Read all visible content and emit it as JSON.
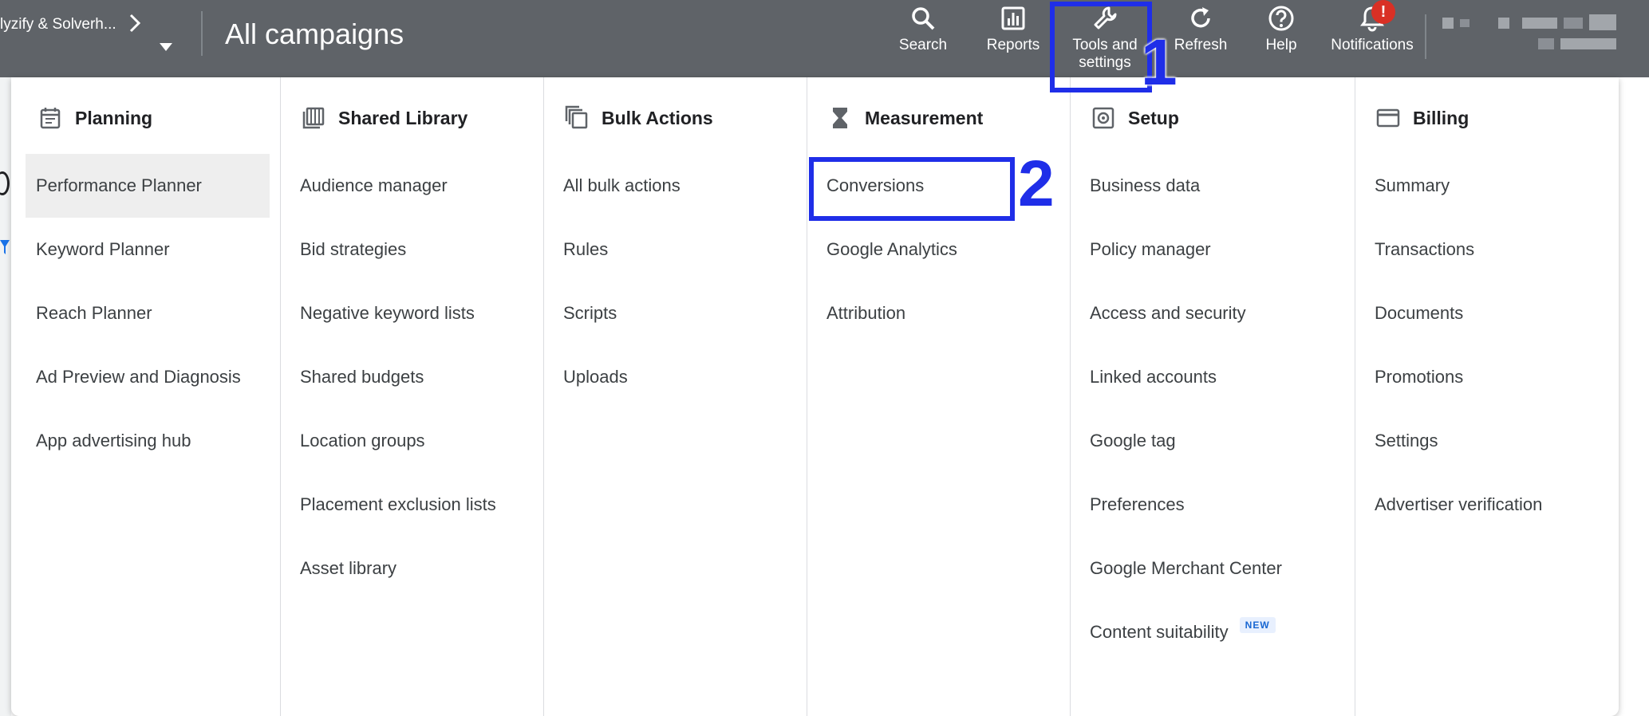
{
  "header": {
    "account_name": "lyzify & Solverh...",
    "page_title": "All campaigns",
    "actions": [
      {
        "id": "search",
        "label": "Search",
        "icon": "search-icon"
      },
      {
        "id": "reports",
        "label": "Reports",
        "icon": "bar-chart-icon"
      },
      {
        "id": "tools",
        "label": "Tools and settings",
        "icon": "wrench-icon"
      },
      {
        "id": "refresh",
        "label": "Refresh",
        "icon": "refresh-icon"
      },
      {
        "id": "help",
        "label": "Help",
        "icon": "help-icon"
      },
      {
        "id": "notifications",
        "label": "Notifications",
        "icon": "bell-icon"
      }
    ],
    "notification_badge": "!",
    "tools_label_line1": "Tools and",
    "tools_label_line2": "settings"
  },
  "menu": {
    "columns": [
      {
        "title": "Planning",
        "icon": "calendar-icon",
        "items": [
          "Performance Planner",
          "Keyword Planner",
          "Reach Planner",
          "Ad Preview and Diagnosis",
          "App advertising hub"
        ],
        "selected": "Performance Planner"
      },
      {
        "title": "Shared Library",
        "icon": "library-icon",
        "items": [
          "Audience manager",
          "Bid strategies",
          "Negative keyword lists",
          "Shared budgets",
          "Location groups",
          "Placement exclusion lists",
          "Asset library"
        ]
      },
      {
        "title": "Bulk Actions",
        "icon": "copy-icon",
        "items": [
          "All bulk actions",
          "Rules",
          "Scripts",
          "Uploads"
        ]
      },
      {
        "title": "Measurement",
        "icon": "hourglass-icon",
        "items": [
          "Conversions",
          "Google Analytics",
          "Attribution"
        ]
      },
      {
        "title": "Setup",
        "icon": "settings-icon",
        "items": [
          "Business data",
          "Policy manager",
          "Access and security",
          "Linked accounts",
          "Google tag",
          "Preferences",
          "Google Merchant Center",
          "Content suitability"
        ],
        "badge_item": "Content suitability",
        "badge": "NEW"
      },
      {
        "title": "Billing",
        "icon": "credit-card-icon",
        "items": [
          "Summary",
          "Transactions",
          "Documents",
          "Promotions",
          "Settings",
          "Advertiser verification"
        ]
      }
    ]
  },
  "annotations": [
    {
      "number": "1",
      "target": "Tools and settings"
    },
    {
      "number": "2",
      "target": "Conversions"
    }
  ],
  "colors": {
    "topbar": "#5f6368",
    "annotation": "#1f2ee8",
    "selected_row": "#eeeeee",
    "notification_badge": "#d93025"
  }
}
